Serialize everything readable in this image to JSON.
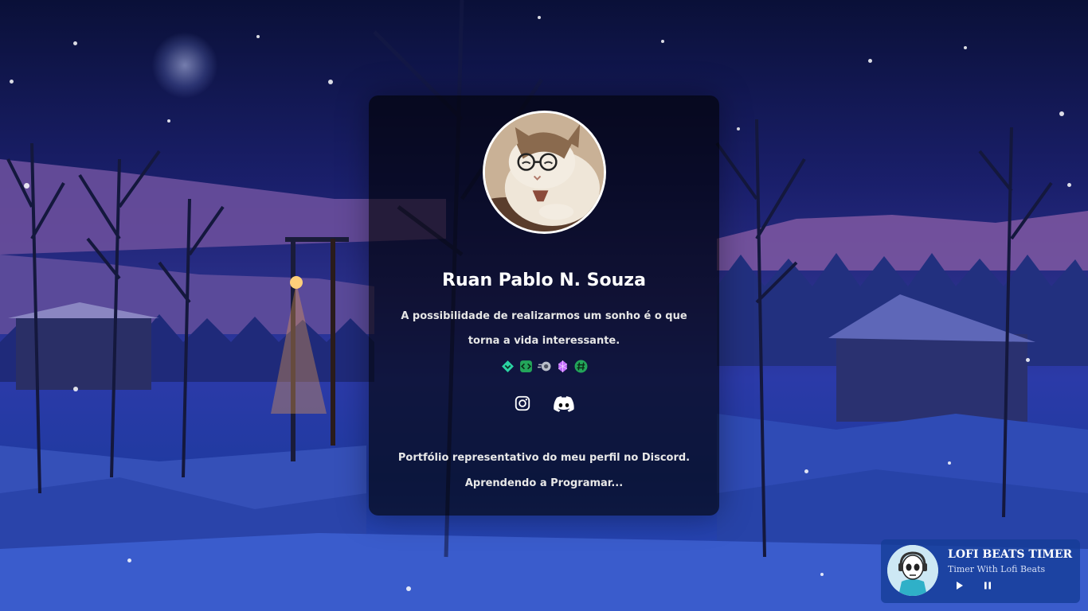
{
  "profile": {
    "name": "Ruan Pablo N. Souza",
    "bio": "A possibilidade de realizarmos um sonho é o que torna a vida interessante.",
    "badges": [
      "hypesquad-brilliance-icon",
      "active-developer-icon",
      "nitro-icon",
      "boost-gem-icon",
      "hashtag-icon"
    ],
    "socials": [
      "instagram-icon",
      "discord-icon"
    ],
    "footer_line1": "Portfólio representativo do meu perfil no Discord.",
    "footer_line2": "Aprendendo a Programar..."
  },
  "player": {
    "title": "LOFI BEATS TIMER",
    "subtitle": "Timer With Lofi Beats",
    "play_icon": "play-icon",
    "pause_icon": "pause-icon"
  },
  "colors": {
    "card_bg": "rgba(0,0,0,0.62)",
    "accent_green": "#23a55a",
    "sky_dark": "#0a1038",
    "snow_blue": "#2c4cc0"
  }
}
